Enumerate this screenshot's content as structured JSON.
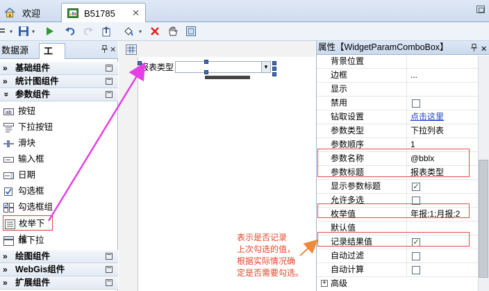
{
  "tabs": {
    "welcome": "欢迎",
    "document": "B51785",
    "close_glyph": "✕"
  },
  "toolbar": {
    "icons": [
      "list-icon",
      "save-icon",
      "run-icon",
      "undo-icon",
      "redo-icon",
      "export-icon",
      "fill-icon",
      "delete-icon",
      "hand-icon",
      "view-icon"
    ]
  },
  "left_panel": {
    "tabs": [
      "数据源",
      "工具"
    ],
    "active_tab": "工具",
    "pin_glyph": "ᵽ",
    "close_glyph": "✕",
    "groups": {
      "basic": "基础组件",
      "stat_chart": "统计图组件",
      "param": "参数组件",
      "draw": "绘图组件",
      "webgis": "WebGis组件",
      "ext": "扩展组件"
    },
    "param_items": [
      "按钮",
      "下拉按钮",
      "滑块",
      "输入框",
      "日期",
      "勾选框",
      "勾选框组",
      "枚举下拉",
      "维下拉"
    ],
    "chevron": "»"
  },
  "canvas": {
    "combo_label": "报表类型"
  },
  "properties": {
    "title": "属性【WidgetParamComboBox】",
    "rows": [
      {
        "name": "背景位置",
        "value": ""
      },
      {
        "name": "边框",
        "value": "..."
      },
      {
        "name": "显示",
        "value": ""
      },
      {
        "name": "禁用",
        "value": ""
      },
      {
        "name": "钻取设置",
        "value": "点击这里"
      },
      {
        "name": "参数类型",
        "value": "下拉列表"
      },
      {
        "name": "参数顺序",
        "value": "1"
      },
      {
        "name": "参数名称",
        "value": "@bblx"
      },
      {
        "name": "参数标题",
        "value": "报表类型"
      },
      {
        "name": "显示参数标题",
        "value": ""
      },
      {
        "name": "允许多选",
        "value": ""
      },
      {
        "name": "枚举值",
        "value": "年报:1;月报:2"
      },
      {
        "name": "默认值",
        "value": ""
      },
      {
        "name": "记录结果值",
        "value": ""
      },
      {
        "name": "自动过滤",
        "value": ""
      },
      {
        "name": "自动计算",
        "value": ""
      }
    ],
    "checked": {
      "禁用": false,
      "显示参数标题": true,
      "允许多选": false,
      "记录结果值": true,
      "自动过滤": false,
      "自动计算": false
    },
    "advanced_label": "高级",
    "expand_glyph": "+"
  },
  "annotation": {
    "lines": [
      "表示是否记录",
      "上次勾选的值，",
      "根据实际情况确",
      "定是否需要勾选。"
    ],
    "color": "#e3462a"
  },
  "colors": {
    "highlight_red": "#e34848",
    "arrow_magenta": "#e63ee6",
    "link_blue": "#1a3fd1"
  }
}
